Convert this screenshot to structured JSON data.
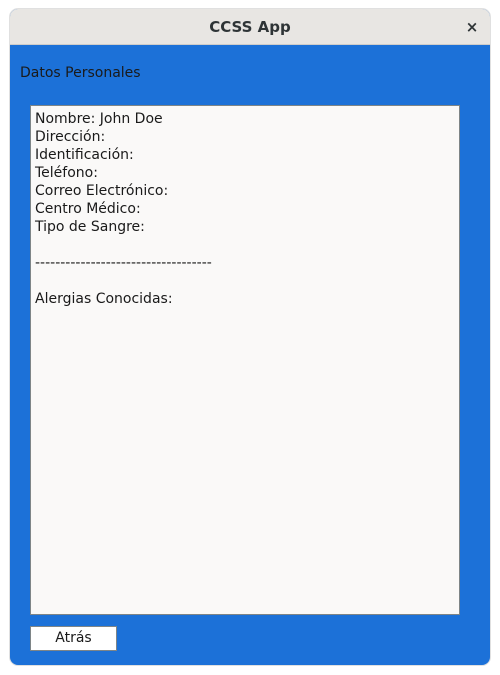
{
  "window": {
    "title": "CCSS App",
    "close_symbol": "×",
    "close_icon": "close-icon"
  },
  "section": {
    "label": "Datos Personales"
  },
  "details": {
    "lines": [
      "Nombre: John Doe",
      "Dirección:",
      "Identificación:",
      "Teléfono:",
      "Correo Electrónico:",
      "Centro Médico:",
      "Tipo de Sangre:",
      "",
      "-----------------------------------",
      "",
      "Alergias Conocidas:"
    ]
  },
  "actions": {
    "back_label": "Atrás"
  },
  "colors": {
    "background": "#1c71d8",
    "titlebar": "#e8e6e3",
    "textarea": "#faf9f8"
  }
}
